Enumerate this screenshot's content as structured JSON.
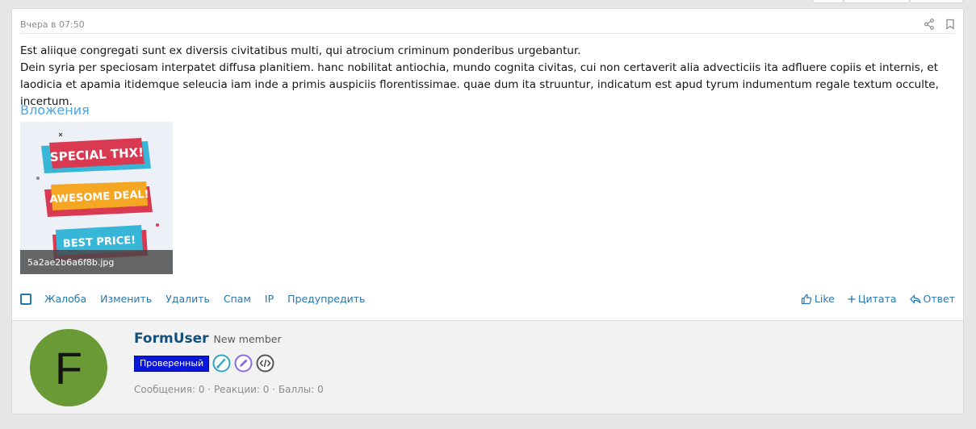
{
  "post": {
    "date": "Вчера в 07:50",
    "body_line1": "Est aliique congregati sunt ex diversis civitatibus multi, qui atrocium criminum ponderibus urgebantur.",
    "body_line2": "Dein syria per speciosam interpatet diffusa planitiem. hanc nobilitat antiochia, mundo cognita civitas, cui non certaverit alia advecticiis ita adfluere copiis et internis, et laodicia et apamia itidemque seleucia iam inde a primis auspiciis florentissimae. quae dum ita struuntur, indicatum est apud tyrum indumentum regale textum occulte, incertum."
  },
  "attachments": {
    "title": "Вложения",
    "file_name": "5a2ae2b6a6f8b.jpg",
    "image_texts": [
      "SPECIAL THX!",
      "AWESOME DEAL!",
      "BEST PRICE!"
    ]
  },
  "actions": {
    "left": [
      "Жалоба",
      "Изменить",
      "Удалить",
      "Спам",
      "IP",
      "Предупредить"
    ],
    "like": "Like",
    "quote": "Цитата",
    "reply": "Ответ"
  },
  "user": {
    "avatar_letter": "F",
    "name": "FormUser",
    "title": "New member",
    "verified_badge": "Проверенный",
    "stats": "Сообщения: 0 · Реакции: 0 · Баллы: 0"
  },
  "colors": {
    "link": "#2577b1",
    "attach_title": "#47a7eb",
    "avatar_bg": "#6a9a35",
    "verified_bg": "#0a16d8"
  },
  "icons": [
    "share-icon",
    "bookmark-icon",
    "thumbs-up-icon",
    "plus-icon",
    "reply-icon",
    "brush-icon",
    "pen-icon",
    "code-icon"
  ]
}
